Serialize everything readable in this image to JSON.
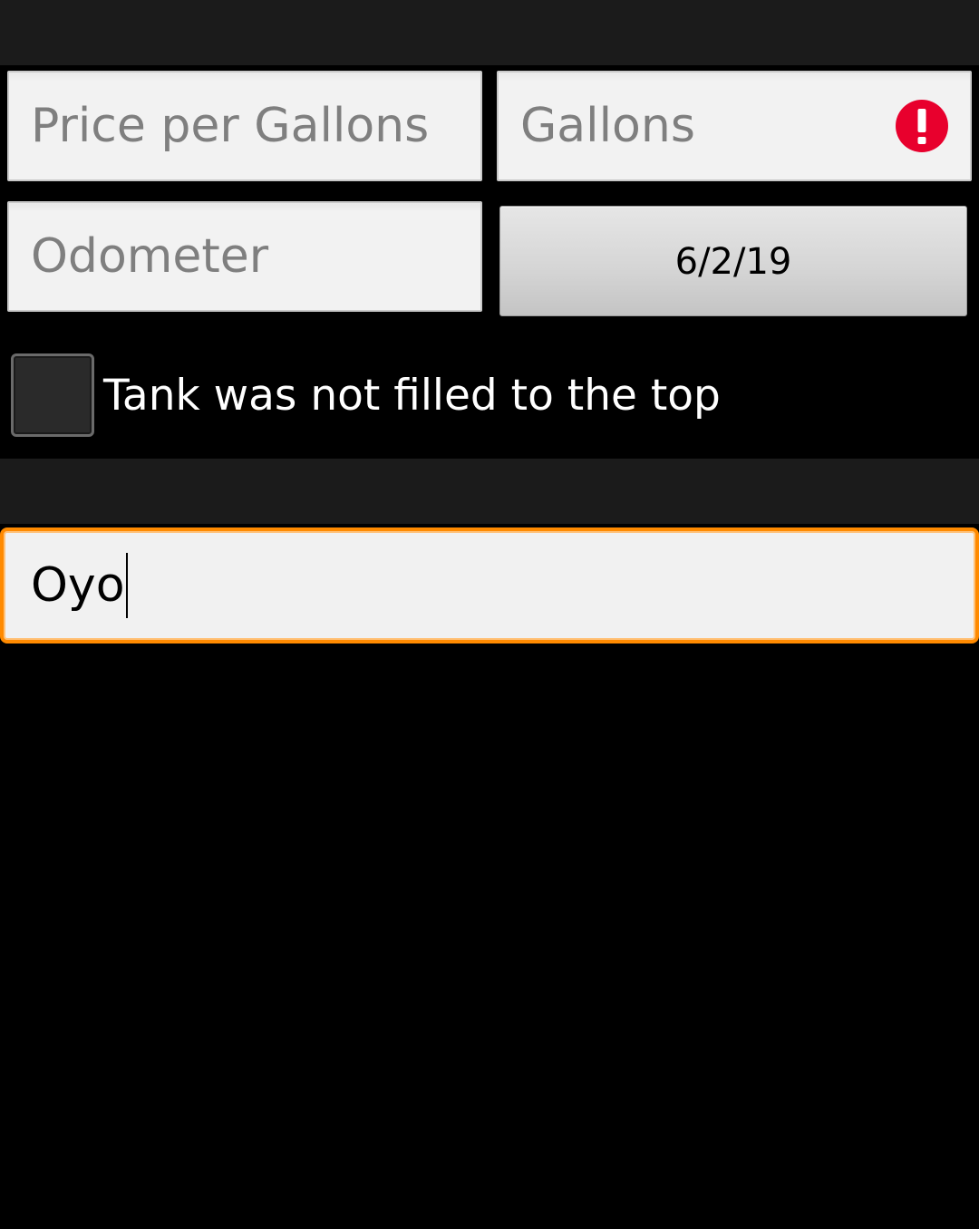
{
  "form": {
    "price_per_gallon": {
      "placeholder": "Price per Gallons",
      "value": ""
    },
    "gallons": {
      "placeholder": "Gallons",
      "value": "",
      "error": true,
      "error_icon": "alert-icon"
    },
    "odometer": {
      "placeholder": "Odometer",
      "value": ""
    },
    "date_button": {
      "label": "6/2/19"
    },
    "partial_fill": {
      "label": "Tank was not filled to the top",
      "checked": false
    },
    "note": {
      "value": "Oyo",
      "focused": true
    }
  },
  "colors": {
    "background": "#000000",
    "band": "#1b1b1b",
    "field": "#f2f2f2",
    "focus_accent": "#ff8a00",
    "error": "#e8002d"
  }
}
